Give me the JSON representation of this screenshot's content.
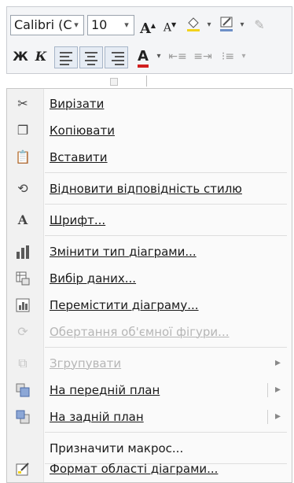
{
  "toolbar": {
    "font_name": "Calibri (C",
    "font_size": "10",
    "grow_font": "A",
    "shrink_font": "A",
    "bold": "Ж",
    "italic": "К",
    "font_color": "A"
  },
  "menu": {
    "items": [
      {
        "label": "Вирізати",
        "icon": "scissors-icon",
        "enabled": true
      },
      {
        "label": "Копіювати",
        "icon": "copy-icon",
        "enabled": true
      },
      {
        "label": "Вставити",
        "icon": "paste-icon",
        "enabled": true
      },
      {
        "label": "Відновити відповідність стилю",
        "icon": "reset-style-icon",
        "enabled": true
      },
      {
        "label": "Шрифт...",
        "icon": "font-icon",
        "enabled": true
      },
      {
        "label": "Змінити тип діаграми...",
        "icon": "chart-type-icon",
        "enabled": true
      },
      {
        "label": "Вибір даних...",
        "icon": "select-data-icon",
        "enabled": true
      },
      {
        "label": "Перемістити діаграму...",
        "icon": "move-chart-icon",
        "enabled": true
      },
      {
        "label": "Обертання об'ємної фігури...",
        "icon": "3d-rotation-icon",
        "enabled": false
      },
      {
        "label": "Згрупувати",
        "icon": "group-icon",
        "enabled": false,
        "submenu": true
      },
      {
        "label": "На передній план",
        "icon": "bring-front-icon",
        "enabled": true,
        "submenu": true
      },
      {
        "label": "На задній план",
        "icon": "send-back-icon",
        "enabled": true,
        "submenu": true
      },
      {
        "label": "Призначити макрос...",
        "icon": "",
        "enabled": true
      },
      {
        "label": "Формат області діаграми...",
        "icon": "format-chart-area-icon",
        "enabled": true
      }
    ],
    "submenu_arrow": "▸"
  },
  "colors": {
    "accent": "#e6ecf4",
    "disabled_text": "#b6b6b6",
    "font_color_bar": "#d11f1f",
    "highlight_bar": "#f2d21b"
  }
}
